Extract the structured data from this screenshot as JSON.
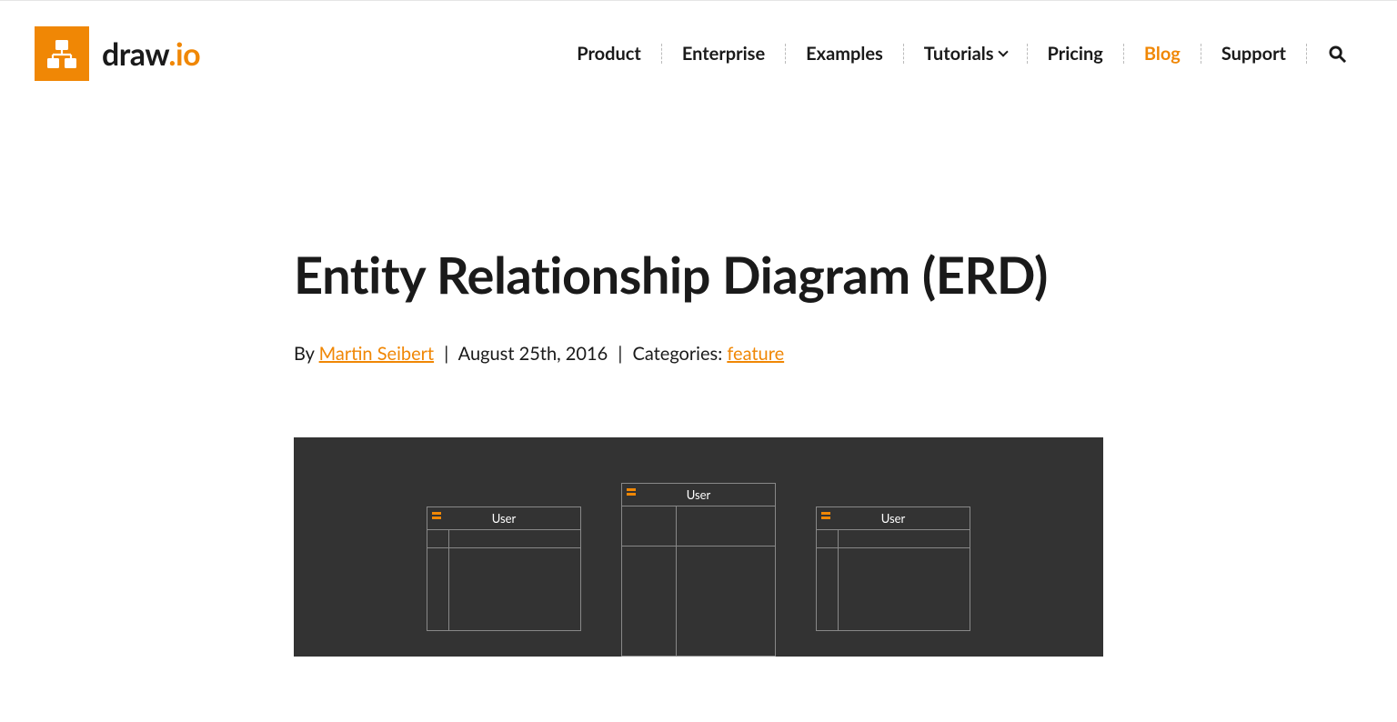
{
  "header": {
    "logo": {
      "name": "draw",
      "suffix": ".io"
    },
    "nav": [
      {
        "label": "Product",
        "active": false,
        "has_dropdown": false
      },
      {
        "label": "Enterprise",
        "active": false,
        "has_dropdown": false
      },
      {
        "label": "Examples",
        "active": false,
        "has_dropdown": false
      },
      {
        "label": "Tutorials",
        "active": false,
        "has_dropdown": true
      },
      {
        "label": "Pricing",
        "active": false,
        "has_dropdown": false
      },
      {
        "label": "Blog",
        "active": true,
        "has_dropdown": false
      },
      {
        "label": "Support",
        "active": false,
        "has_dropdown": false
      }
    ]
  },
  "post": {
    "title": "Entity Relationship Diagram (ERD)",
    "meta": {
      "by_prefix": "By ",
      "author": "Martin Seibert",
      "date": "August 25th, 2016",
      "categories_label": "Categories: ",
      "category": "feature"
    },
    "hero": {
      "entities": [
        {
          "label": "User"
        },
        {
          "label": "User"
        },
        {
          "label": "User"
        }
      ]
    }
  },
  "colors": {
    "accent": "#f08705",
    "hero_bg": "#333333"
  }
}
